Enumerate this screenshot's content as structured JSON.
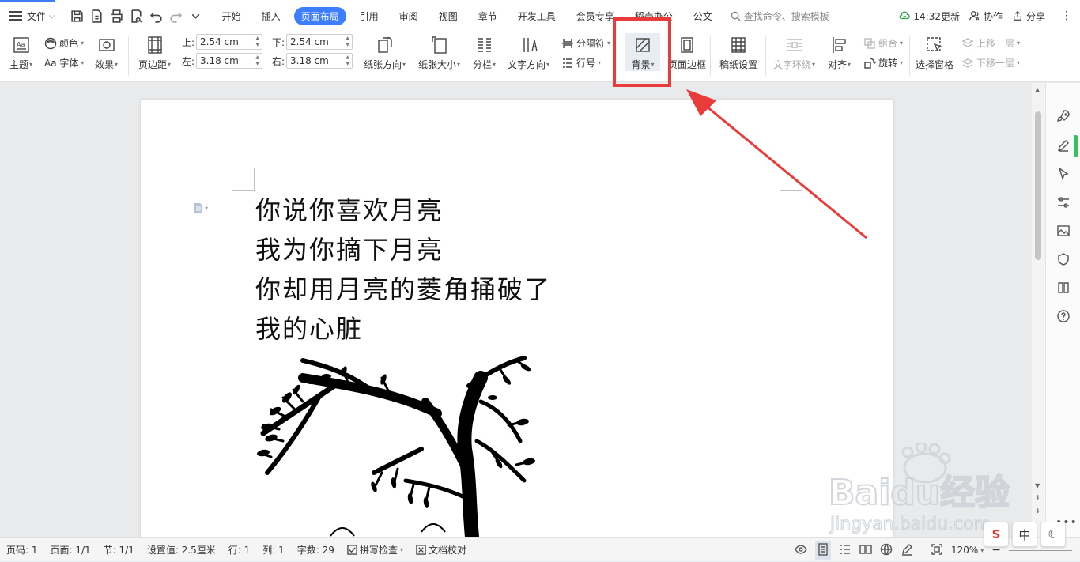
{
  "menubar": {
    "file_label": "文件",
    "tabs": [
      "开始",
      "插入",
      "页面布局",
      "引用",
      "审阅",
      "视图",
      "章节",
      "开发工具",
      "会员专享",
      "稻壳办公",
      "公文"
    ],
    "active_tab": "页面布局",
    "search_label": "查找命令、搜索模板",
    "update_label": "14:32更新",
    "collab_label": "协作",
    "share_label": "分享"
  },
  "ribbon": {
    "theme": "主题",
    "color": "颜色",
    "font": "Aa 字体",
    "effect": "效果",
    "margins": "页边距",
    "margin_top_label": "上:",
    "margin_top_value": "2.54 cm",
    "margin_bottom_label": "下:",
    "margin_bottom_value": "2.54 cm",
    "margin_left_label": "左:",
    "margin_left_value": "3.18 cm",
    "margin_right_label": "右:",
    "margin_right_value": "3.18 cm",
    "orientation": "纸张方向",
    "paper_size": "纸张大小",
    "columns": "分栏",
    "text_direction": "文字方向",
    "separator": "分隔符",
    "line_number": "行号",
    "background": "背景",
    "page_border": "页面边框",
    "draft_setting": "稿纸设置",
    "text_wrap": "文字环绕",
    "align": "对齐",
    "group": "组合",
    "rotate": "旋转",
    "selection_pane": "选择窗格",
    "bring_forward": "上移一层",
    "send_backward": "下移一层"
  },
  "document": {
    "poem": [
      "你说你喜欢月亮",
      "我为你摘下月亮",
      "你却用月亮的菱角捅破了",
      "我的心脏"
    ]
  },
  "statusbar": {
    "page_num": "页码: 1",
    "pages": "页面: 1/1",
    "section": "节: 1/1",
    "setting": "设置值: 2.5厘米",
    "row": "行: 1",
    "col": "列: 1",
    "word_count": "字数: 29",
    "spell_check": "拼写检查",
    "doc_proof": "文档校对",
    "zoom": "120%"
  },
  "ime": {
    "sogou": "S",
    "lang": "中"
  },
  "watermark": {
    "brand": "Baidu经验",
    "url": "jingyan.baidu.com"
  },
  "colors": {
    "accent": "#3d7eff",
    "highlight": "#ea3b3b"
  }
}
